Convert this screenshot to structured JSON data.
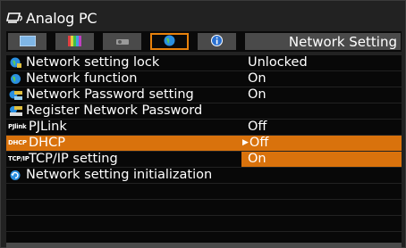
{
  "header": {
    "source_icon": "analog-pc-icon",
    "title": "Analog PC"
  },
  "tabs": [
    {
      "icon": "picture-icon",
      "active": false
    },
    {
      "icon": "color-bars-icon",
      "active": false
    },
    {
      "icon": "projector-icon",
      "active": false
    },
    {
      "icon": "network-globe-icon",
      "active": true
    },
    {
      "icon": "info-icon",
      "active": false
    }
  ],
  "menu_title": "Network Setting",
  "items": [
    {
      "icon": "network-lock-icon",
      "label": "Network setting lock",
      "value": "Unlocked"
    },
    {
      "icon": "globe-icon",
      "label": "Network function",
      "value": "On"
    },
    {
      "icon": "password-icon",
      "label": "Network Password setting",
      "value": "On"
    },
    {
      "icon": "register-password-icon",
      "label": "Register Network Password",
      "value": ""
    },
    {
      "icon": "pjlink-icon",
      "icon_text": "PJlink",
      "label": "PJLink",
      "value": "Off"
    },
    {
      "icon": "dhcp-icon",
      "icon_text": "DHCP",
      "label": "DHCP",
      "value": "Off"
    },
    {
      "icon": "tcpip-icon",
      "icon_text": "TCP/IP",
      "label": "TCP/IP setting",
      "value": "On"
    },
    {
      "icon": "initialize-icon",
      "label": "Network setting initialization",
      "value": ""
    }
  ],
  "colors": {
    "highlight": "#d9720c",
    "tab_active_border": "#e8820c",
    "row_bg": "#080808"
  }
}
